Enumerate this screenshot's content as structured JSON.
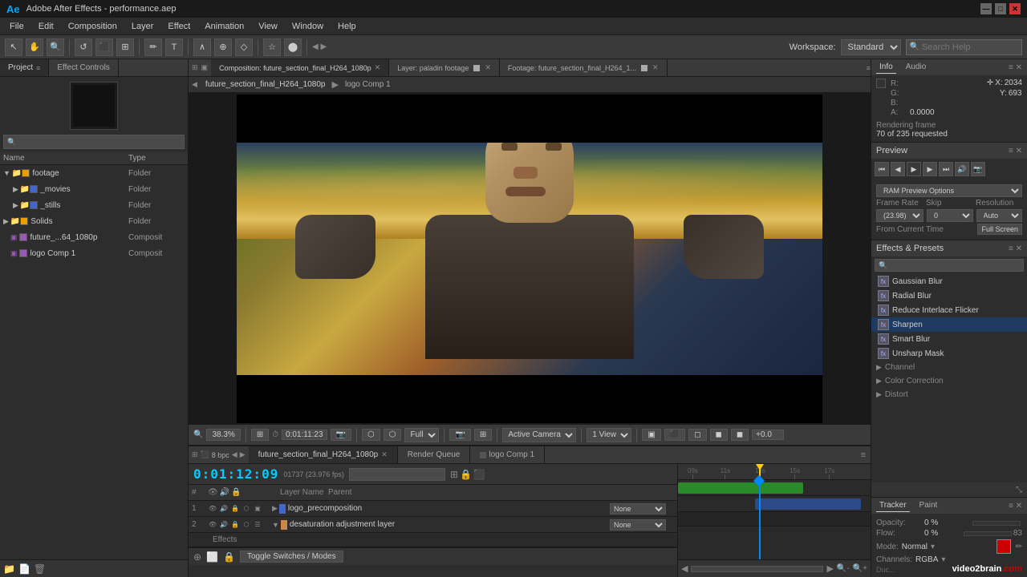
{
  "titlebar": {
    "title": "Adobe After Effects - performance.aep",
    "logo": "Ae"
  },
  "menu": {
    "items": [
      "File",
      "Edit",
      "Composition",
      "Layer",
      "Effect",
      "Animation",
      "View",
      "Window",
      "Help"
    ]
  },
  "toolbar": {
    "workspace_label": "Workspace:",
    "workspace_options": [
      "Standard"
    ],
    "workspace_selected": "Standard",
    "search_placeholder": "Search Help"
  },
  "project_panel": {
    "title": "Project",
    "search_placeholder": "Search",
    "columns": {
      "name": "Name",
      "type": "Type"
    },
    "items": [
      {
        "name": "footage",
        "type": "Folder",
        "indent": 0,
        "expanded": true,
        "color": "#e8a000",
        "kind": "folder"
      },
      {
        "name": "_movies",
        "type": "Folder",
        "indent": 1,
        "expanded": false,
        "color": "#4466cc",
        "kind": "folder"
      },
      {
        "name": "_stills",
        "type": "Folder",
        "indent": 1,
        "expanded": false,
        "color": "#4466cc",
        "kind": "folder"
      },
      {
        "name": "Solids",
        "type": "Folder",
        "indent": 0,
        "expanded": false,
        "color": "#e8a000",
        "kind": "folder"
      },
      {
        "name": "future_...64_1080p",
        "type": "Composit",
        "indent": 0,
        "expanded": false,
        "color": "#9b59b6",
        "kind": "comp"
      },
      {
        "name": "logo Comp 1",
        "type": "Composit",
        "indent": 0,
        "expanded": false,
        "color": "#9b59b6",
        "kind": "comp"
      }
    ]
  },
  "tabs": {
    "composition": "Composition: future_section_final_H264_1080p",
    "layer": "Layer: paladin footage",
    "footage": "Footage: future_section_final_H264_1...",
    "effect_controls": "Effect Controls",
    "sub_tabs": [
      "future_section_final_H264_1080p",
      "logo Comp 1"
    ]
  },
  "comp_viewer": {
    "zoom": "38.3%",
    "timecode": "0:01:11:23",
    "quality": "Full",
    "camera": "Active Camera",
    "view": "1 View",
    "value": "+0.0",
    "resolution_label": "Full"
  },
  "info_panel": {
    "title": "Info",
    "audio_tab": "Audio",
    "r_label": "R:",
    "g_label": "G:",
    "b_label": "B:",
    "a_label": "A:",
    "r_value": "",
    "g_value": "",
    "b_value": "",
    "a_value": "0.0000",
    "x_label": "X:",
    "y_label": "Y:",
    "x_value": "2034",
    "y_value": "693",
    "rendering_label": "Rendering frame",
    "rendering_info": "70 of 235 requested"
  },
  "preview_panel": {
    "title": "Preview",
    "buttons": [
      "⏮",
      "◀◀",
      "▶",
      "▶▶",
      "⏭",
      "🔊",
      "📷"
    ],
    "options_label": "RAM Preview Options",
    "frame_rate_label": "Frame Rate",
    "skip_label": "Skip",
    "resolution_label": "Resolution",
    "frame_rate_value": "(23.98)",
    "skip_value": "0",
    "resolution_value": "Auto",
    "from_current": "From Current Time",
    "full_screen": "Full Screen"
  },
  "effects_panel": {
    "title": "Effects & Presets",
    "effects": [
      {
        "name": "Gaussian Blur",
        "selected": false
      },
      {
        "name": "Radial Blur",
        "selected": false
      },
      {
        "name": "Reduce Interlace Flicker",
        "selected": false
      },
      {
        "name": "Sharpen",
        "selected": true
      },
      {
        "name": "Smart Blur",
        "selected": false
      },
      {
        "name": "Unsharp Mask",
        "selected": false
      }
    ],
    "categories": [
      {
        "name": "Channel"
      },
      {
        "name": "Color Correction"
      },
      {
        "name": "Distort"
      }
    ]
  },
  "tracker_panel": {
    "title": "Tracker",
    "paint_tab": "Paint",
    "opacity_label": "Opacity:",
    "opacity_value": "0 %",
    "flow_label": "Flow:",
    "flow_value": "0 %",
    "flow_number": "83",
    "mode_label": "Mode:",
    "mode_value": "Normal",
    "channels_label": "Channels:",
    "channels_value": "RGBA"
  },
  "timeline": {
    "tabs": [
      {
        "name": "future_section_final_H264_1080p",
        "active": true
      },
      {
        "name": "Render Queue",
        "active": false
      },
      {
        "name": "logo Comp 1",
        "active": false
      }
    ],
    "time_display": "0:01:12:09",
    "frame_info": "01737 (23.976 fps)",
    "fps_label": "8 bpc",
    "layers": [
      {
        "num": "1",
        "name": "logo_precomposition",
        "color": "#4466cc",
        "parent": "None",
        "has_expand": true,
        "expanded": false
      },
      {
        "num": "2",
        "name": "desaturation adjustment layer",
        "color": "#cc8844",
        "parent": "None",
        "has_expand": true,
        "expanded": true
      }
    ],
    "sublayers": [
      {
        "name": "Effects"
      }
    ],
    "ruler_marks": [
      "09s",
      "11s",
      "13s",
      "15s",
      "17s"
    ],
    "playhead_pos": "45%",
    "toggle_switches": "Toggle Switches / Modes"
  },
  "watermark": {
    "text1": "video2brain",
    "text2": ".com"
  }
}
